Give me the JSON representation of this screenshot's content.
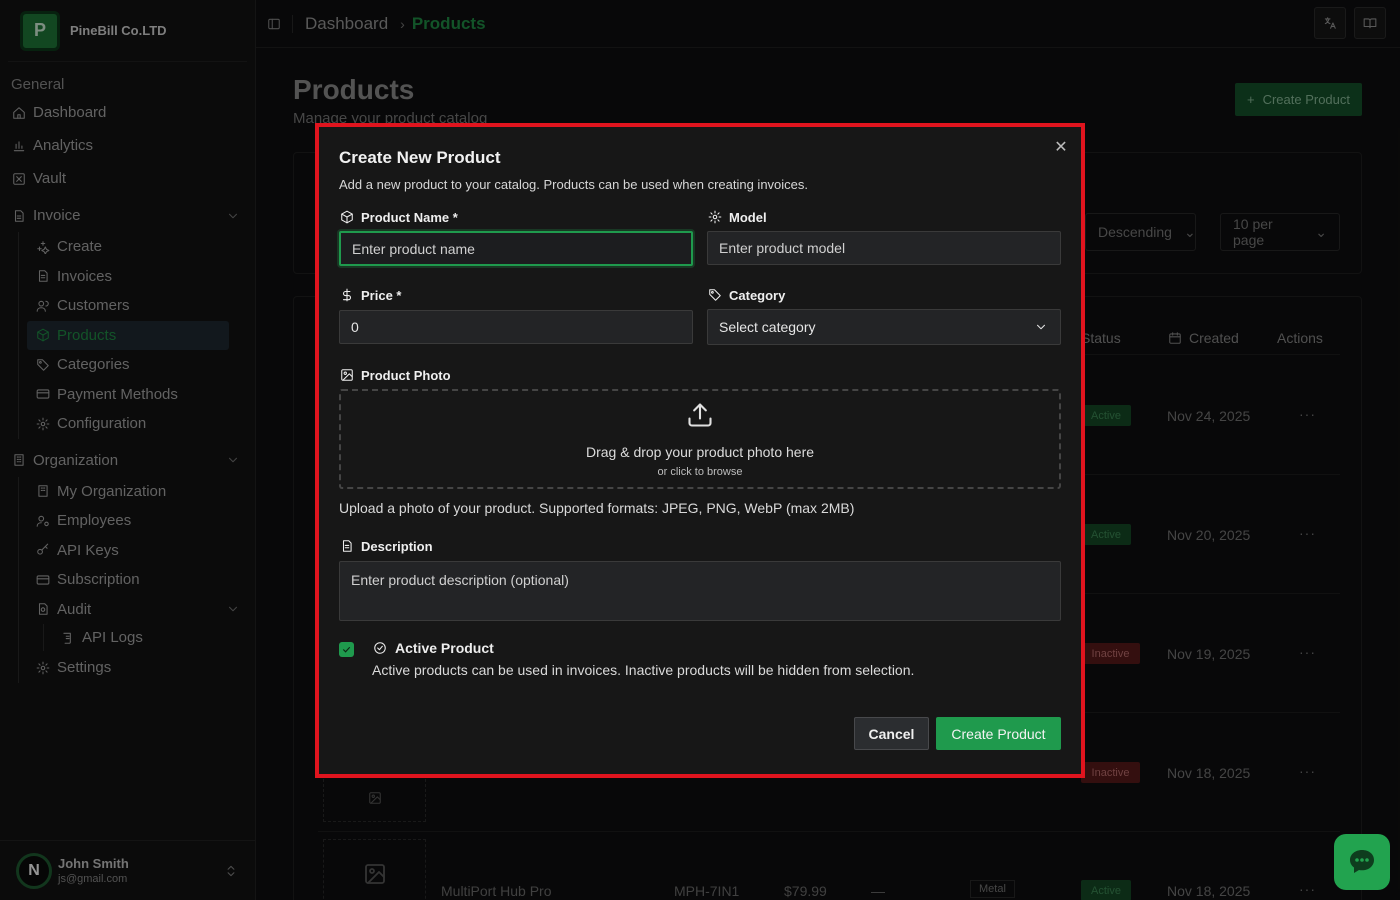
{
  "brand": {
    "name": "PineBill Co.LTD",
    "logo_letter": "P"
  },
  "sidebar": {
    "general_heading": "General",
    "dashboard": "Dashboard",
    "analytics": "Analytics",
    "vault": "Vault",
    "invoice": "Invoice",
    "invoice_items": [
      "Create",
      "Invoices",
      "Customers",
      "Products",
      "Categories",
      "Payment Methods",
      "Configuration"
    ],
    "organization": "Organization",
    "org_items": [
      "My Organization",
      "Employees",
      "API Keys",
      "Subscription",
      "Audit"
    ],
    "audit_items": [
      "API Logs"
    ],
    "settings": "Settings",
    "active_item": "Products"
  },
  "user": {
    "initial": "N",
    "name": "John Smith",
    "email": "js@gmail.com"
  },
  "breadcrumb": {
    "root": "Dashboard",
    "current": "Products",
    "separator": "›"
  },
  "page": {
    "title": "Products",
    "subtitle": "Manage your product catalog",
    "create_button": "Create Product",
    "sort_select": "Descending",
    "per_page_select": "10 per page"
  },
  "table": {
    "headers": {
      "status": "Status",
      "created": "Created",
      "actions": "Actions"
    },
    "rows": [
      {
        "status": "Active",
        "created": "Nov 24, 2025"
      },
      {
        "status": "Active",
        "created": "Nov 20, 2025"
      },
      {
        "status": "Inactive",
        "created": "Nov 19, 2025"
      },
      {
        "status": "Inactive",
        "created": "Nov 18, 2025"
      },
      {
        "name": "MultiPort Hub Pro",
        "model": "MPH-7IN1",
        "price": "$79.99",
        "dash": "—",
        "category": "Metal",
        "status": "Active",
        "created": "Nov 18, 2025"
      }
    ],
    "actions_glyph": "···"
  },
  "modal": {
    "title": "Create New Product",
    "description": "Add a new product to your catalog. Products can be used when creating invoices.",
    "close_glyph": "✕",
    "product_name_label": "Product Name *",
    "product_name_placeholder": "Enter product name",
    "model_label": "Model",
    "model_placeholder": "Enter product model",
    "price_label": "Price *",
    "price_value": "0",
    "category_label": "Category",
    "category_value": "Select category",
    "photo_label": "Product Photo",
    "drop_main": "Drag & drop your product photo here",
    "drop_sub": "or click to browse",
    "photo_help": "Upload a photo of your product. Supported formats: JPEG, PNG, WebP (max 2MB)",
    "description_label": "Description",
    "description_placeholder": "Enter product description (optional)",
    "active_label": "Active Product",
    "active_desc": "Active products can be used in invoices. Inactive products will be hidden from selection.",
    "active_checked": true,
    "cancel_button": "Cancel",
    "create_button": "Create Product"
  },
  "colors": {
    "accent": "#1f9a4d",
    "highlight_frame": "#e0141e"
  }
}
